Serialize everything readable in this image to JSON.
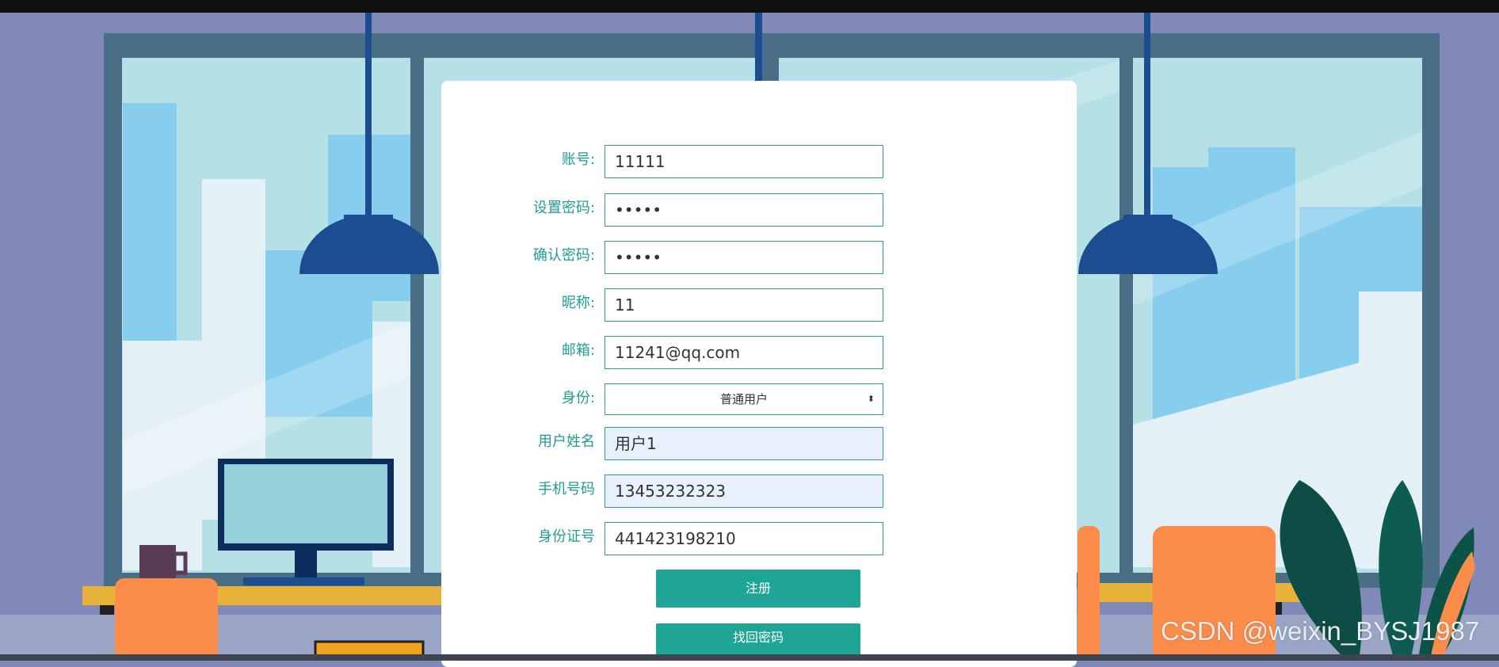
{
  "form": {
    "account": {
      "label": "账号:",
      "value": "11111"
    },
    "password": {
      "label": "设置密码:",
      "value": "•••••"
    },
    "confirm_password": {
      "label": "确认密码:",
      "value": "•••••"
    },
    "nickname": {
      "label": "昵称:",
      "value": "11"
    },
    "email": {
      "label": "邮箱:",
      "value": "11241@qq.com"
    },
    "role": {
      "label": "身份:",
      "selected": "普通用户"
    },
    "user_name": {
      "label": "用户姓名",
      "value": "用户1"
    },
    "phone": {
      "label": "手机号码",
      "value": "13453232323"
    },
    "id_number": {
      "label": "身份证号",
      "value": "441423198210"
    },
    "register_label": "注册",
    "recover_label": "找回密码"
  },
  "watermark": "CSDN @weixin_BYSJ1987",
  "colors": {
    "accent": "#1ea596",
    "background": "#8189b8",
    "window_frame": "#4a6e85",
    "lamp": "#1c4d91",
    "chair": "#fb8c4a"
  }
}
